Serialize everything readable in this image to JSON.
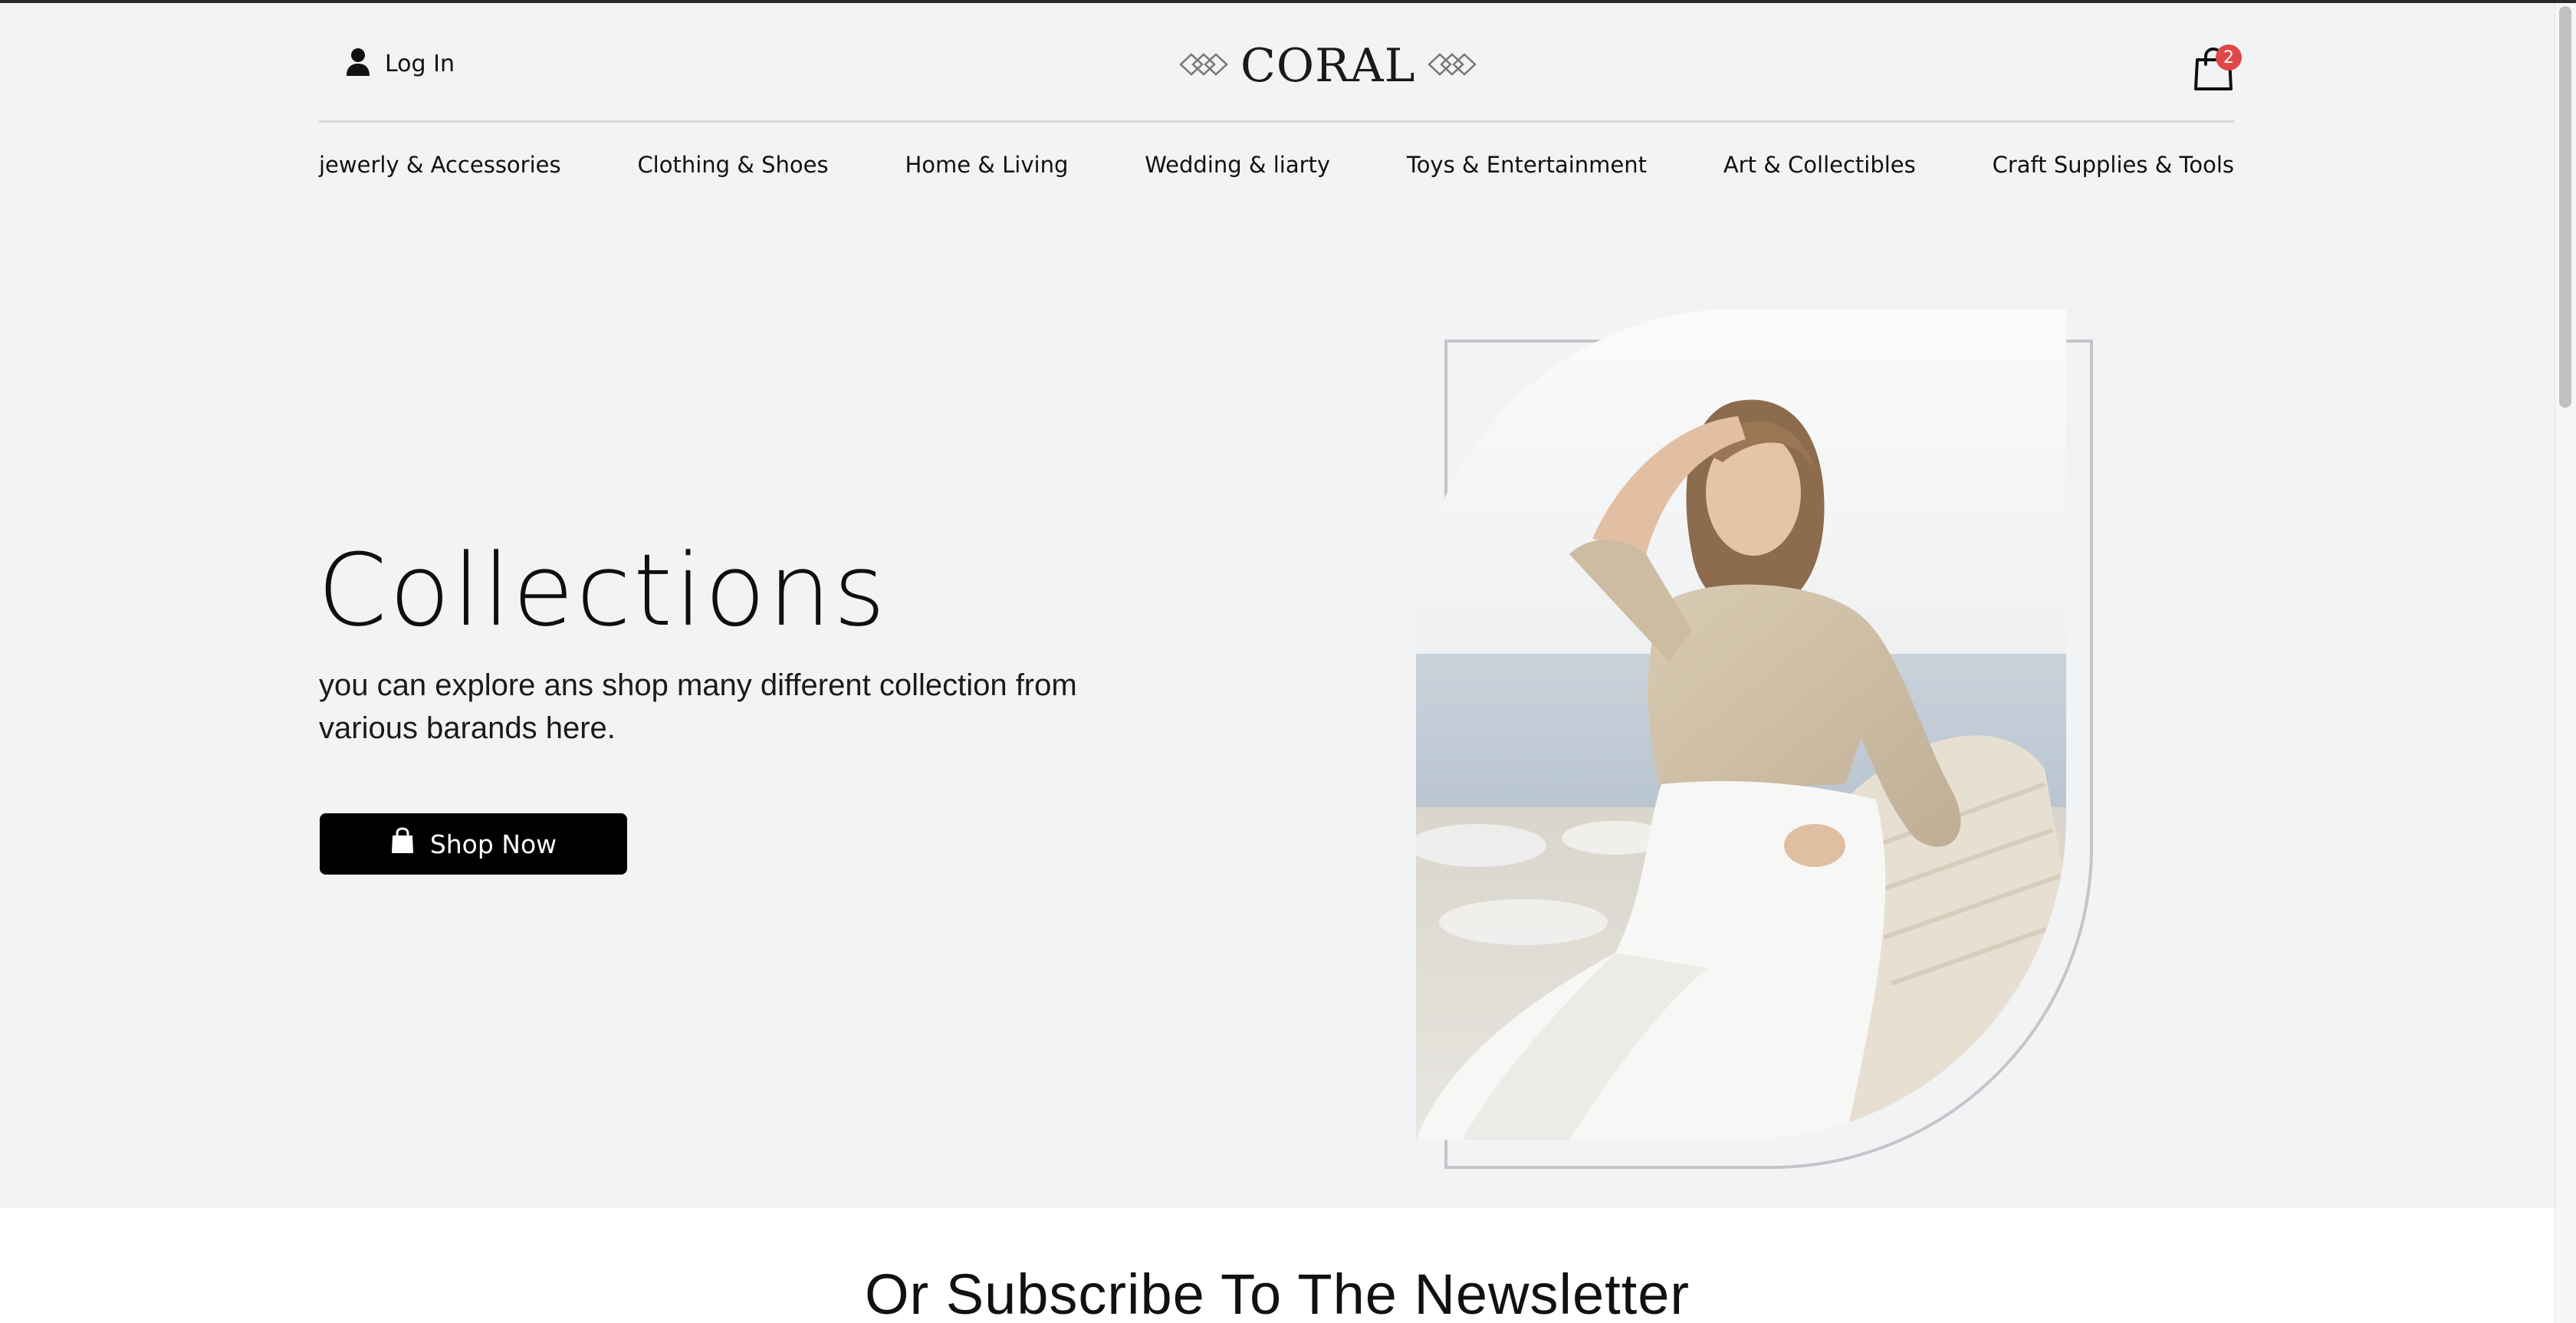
{
  "header": {
    "login_label": "Log In",
    "logo_text": "CORAL",
    "cart_count": "2"
  },
  "nav": {
    "items": [
      "jewerly & Accessories",
      "Clothing & Shoes",
      "Home & Living",
      "Wedding & liarty",
      "Toys & Entertainment",
      "Art & Collectibles",
      "Craft Supplies & Tools"
    ]
  },
  "hero": {
    "title": "Collections",
    "subtitle": "you can explore ans shop many different collection from various barands here.",
    "button_label": "Shop Now",
    "image_icon": "model-photo"
  },
  "newsletter": {
    "title": "Or Subscribe To The Newsletter"
  },
  "icons": {
    "login": "user-icon",
    "cart": "shopping-bag-icon",
    "button": "shopping-bag-icon",
    "logo_ornament": "diamond-ornament-icon"
  },
  "colors": {
    "background": "#f2f3f5",
    "button": "#000000",
    "badge": "#e04848",
    "section_white": "#ffffff"
  }
}
